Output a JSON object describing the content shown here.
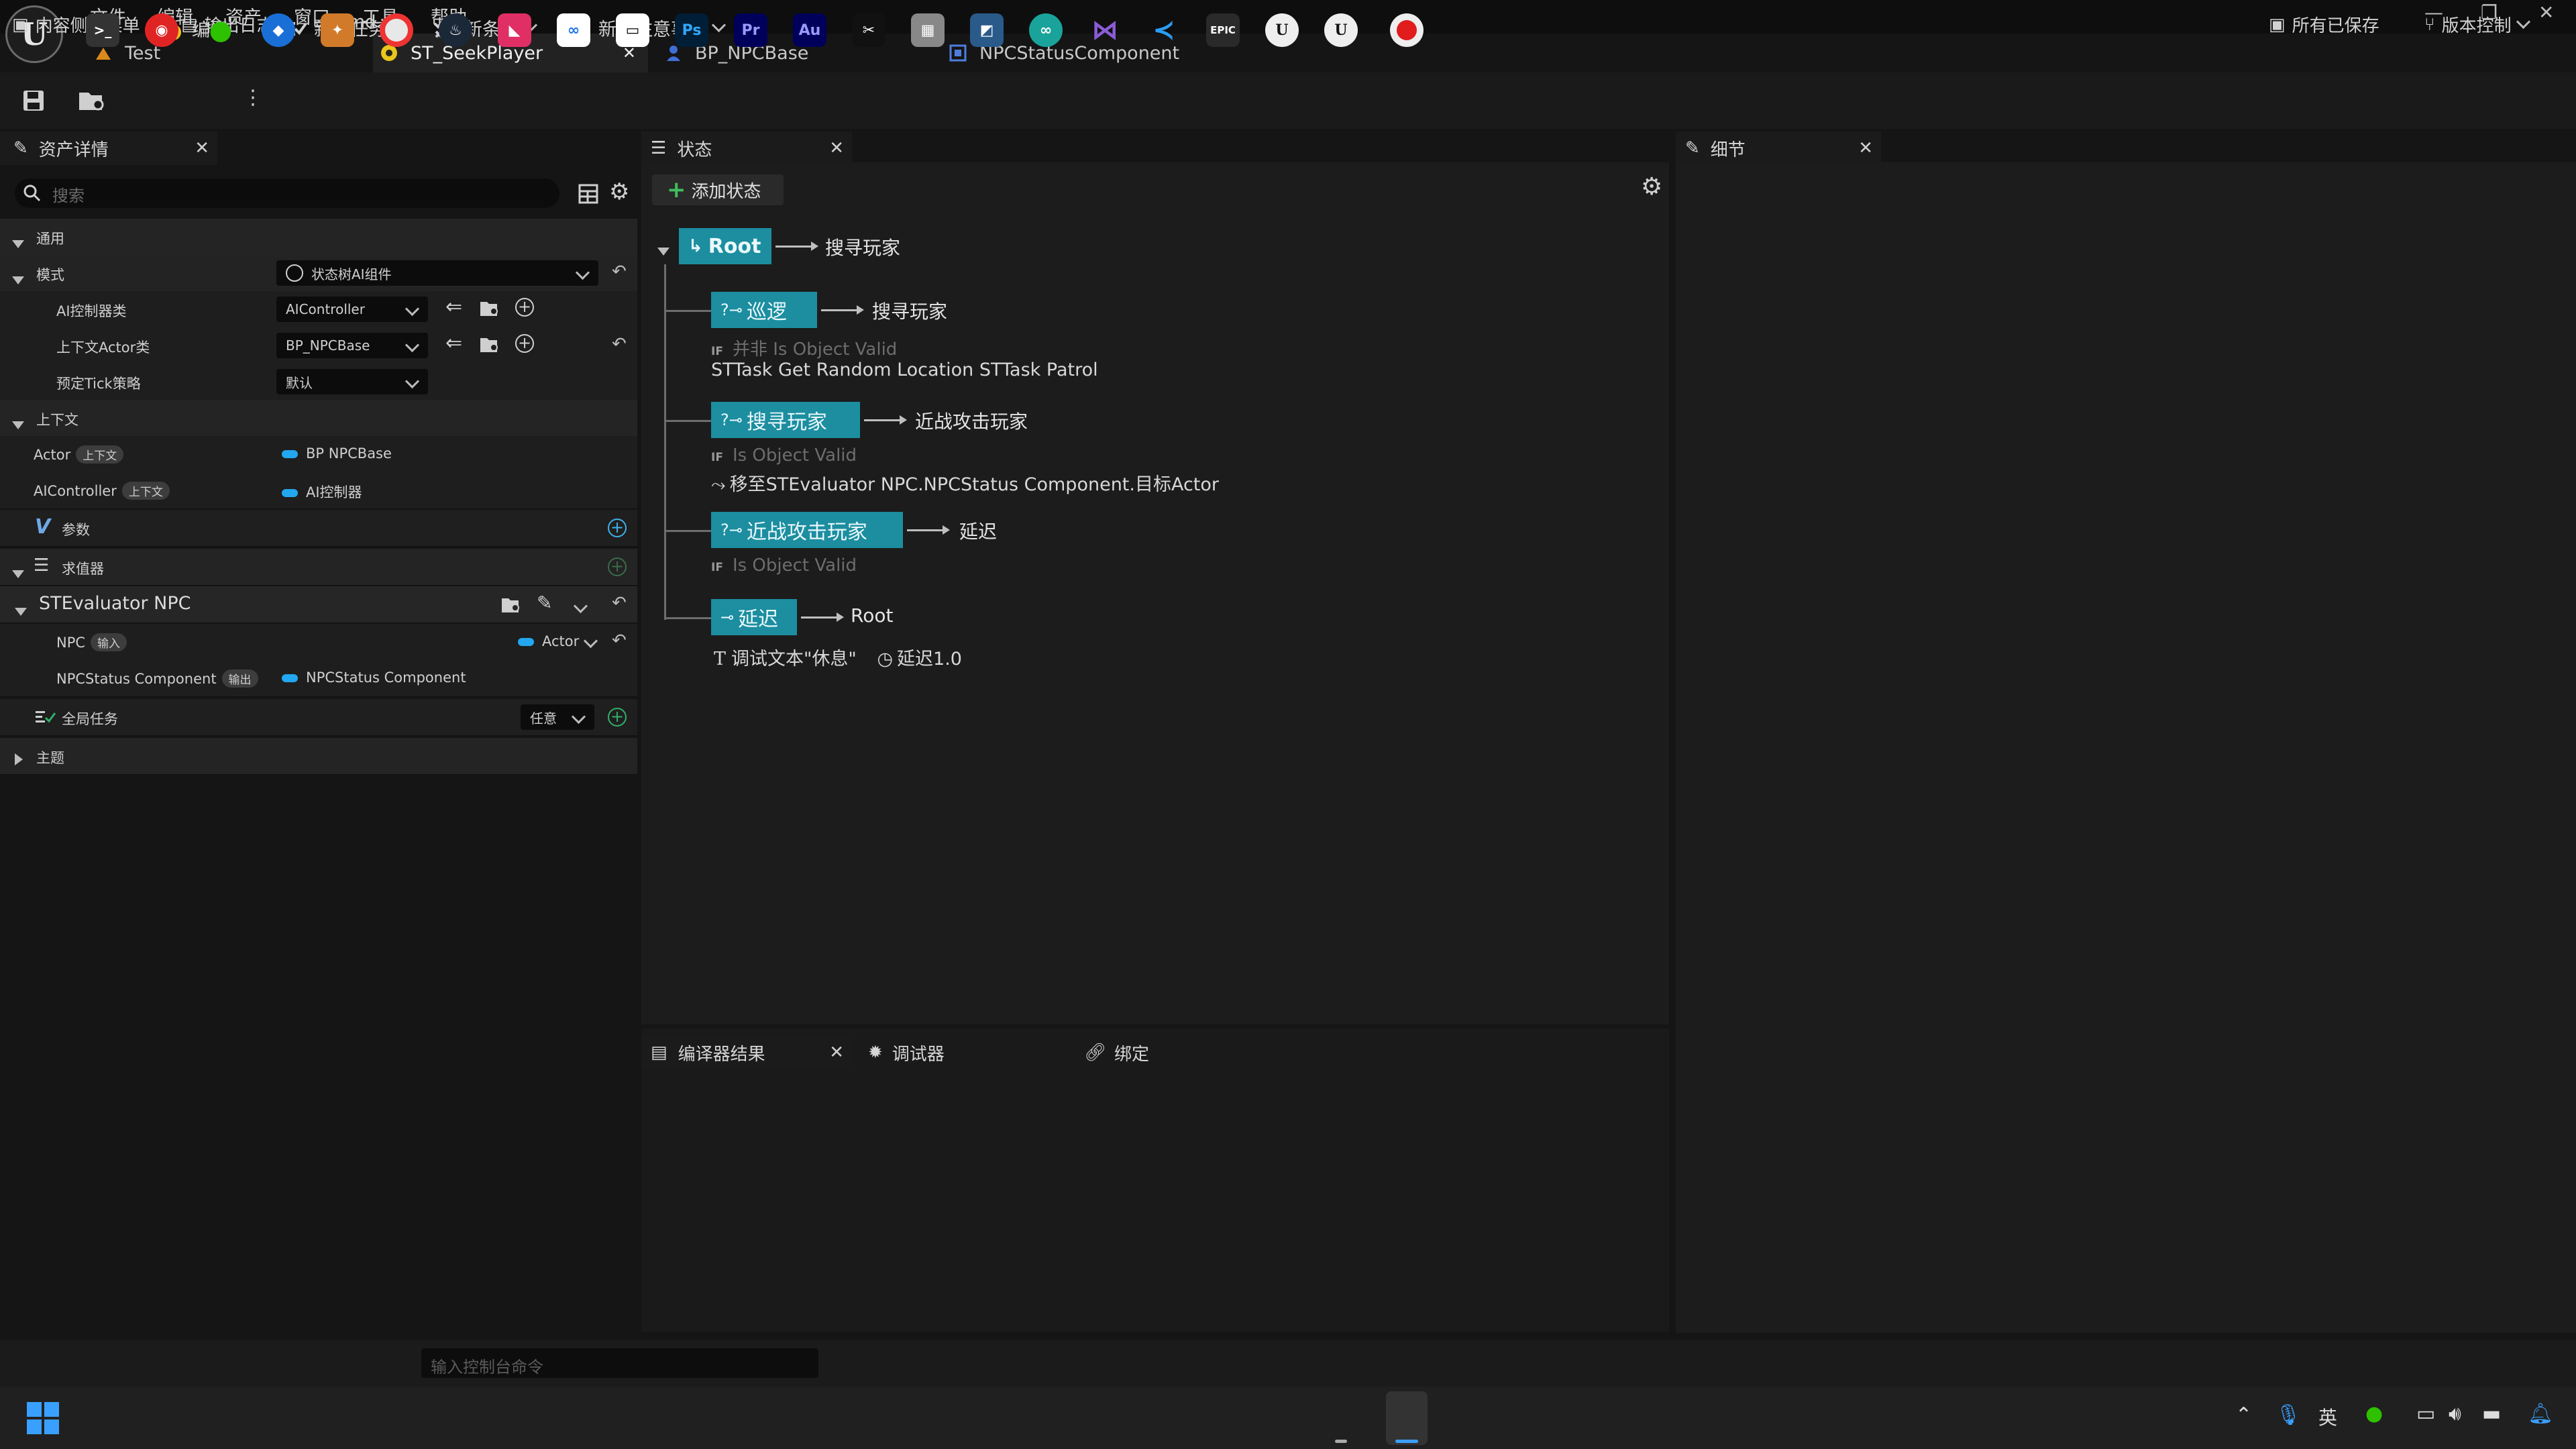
{
  "menu": [
    "文件",
    "编辑",
    "资产",
    "窗口",
    "工具",
    "帮助"
  ],
  "logo": "U",
  "window_controls": [
    "—",
    "❐",
    "✕"
  ],
  "doc_tabs": [
    "Test",
    "ST_SeekPlayer",
    "BP_NPCBase",
    "NPCStatusComponent"
  ],
  "toolbar": {
    "compile": "编译",
    "new_task": "新建任务",
    "new_condition": "新条件",
    "new_consideration": "新建注意事项"
  },
  "left_panel": {
    "tab_title": "资产详情",
    "search_placeholder": "搜索",
    "cat_general": "通用",
    "cat_mode": "模式",
    "mode_value": "状态树AI组件",
    "ai_controller_class_label": "AI控制器类",
    "ai_controller_class_value": "AIController",
    "context_actor_class_label": "上下文Actor类",
    "context_actor_class_value": "BP_NPCBase",
    "tick_policy_label": "预定Tick策略",
    "tick_policy_value": "默认",
    "cat_context": "上下文",
    "actor_label": "Actor",
    "actor_pill": "上下文",
    "actor_value": "BP NPCBase",
    "aicontroller_label": "AIController",
    "aicontroller_pill": "上下文",
    "aicontroller_value": "AI控制器",
    "params": "参数",
    "evaluators": "求值器",
    "evaluator_name": "STEvaluator NPC",
    "npc_label": "NPC",
    "npc_pill": "输入",
    "npc_value": "Actor",
    "npcstatus_label": "NPCStatus Component",
    "npcstatus_pill": "输出",
    "npcstatus_value": "NPCStatus Component",
    "global_tasks": "全局任务",
    "global_tasks_value": "任意",
    "theme": "主题"
  },
  "state_panel": {
    "tab_title": "状态",
    "add_state": "添加状态",
    "nodes": [
      {
        "name": "Root",
        "target": "搜寻玩家"
      },
      {
        "name": "巡逻",
        "target": "搜寻玩家",
        "cond": "并非 Is Object Valid",
        "tasks": "STTask Get Random Location   STTask Patrol"
      },
      {
        "name": "搜寻玩家",
        "target": "近战攻击玩家",
        "cond": "Is Object Valid",
        "tasks": "移至STEvaluator NPC.NPCStatus Component.目标Actor"
      },
      {
        "name": "近战攻击玩家",
        "target": "延迟",
        "cond": "Is Object Valid"
      },
      {
        "name": "延迟",
        "target": "Root",
        "tasks_text": "调试文本\"休息\"",
        "tasks_delay": "延迟1.0"
      }
    ],
    "if": "IF"
  },
  "bottom_tabs": [
    "编译器结果",
    "调试器",
    "绑定"
  ],
  "details_panel": {
    "tab_title": "细节"
  },
  "statusbar": {
    "content_drawer": "内容侧滑菜单",
    "output_log": "输出日志",
    "cmd": "Cmd",
    "console_placeholder": "输入控制台命令",
    "all_saved": "所有已保存",
    "source_control": "版本控制"
  },
  "taskbar": {
    "apps": [
      "Ps",
      "Pr",
      "Au",
      "EPIC",
      "U",
      "U"
    ],
    "ime": "英"
  },
  "colors": {
    "accent": "#1c8ea0",
    "pin_blue": "#22a7f0"
  }
}
